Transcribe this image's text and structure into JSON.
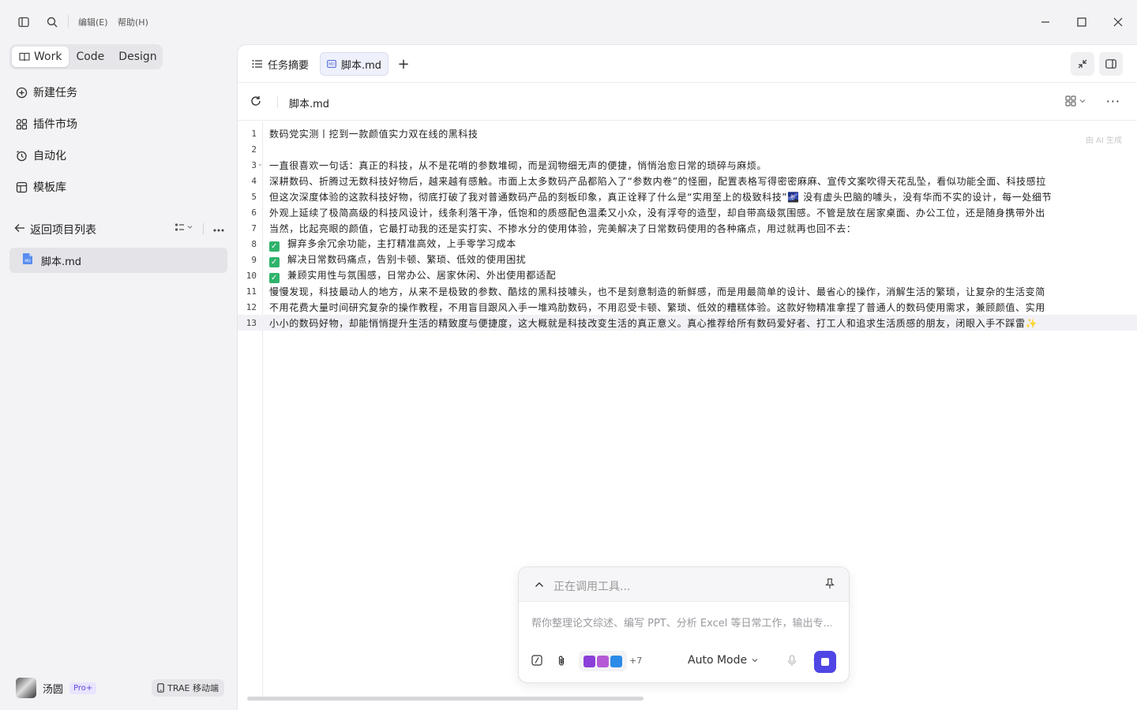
{
  "titlebar": {
    "menu_edit": "编辑(E)",
    "menu_help": "帮助(H)"
  },
  "sidebar": {
    "modes": [
      "Work",
      "Code",
      "Design"
    ],
    "nav": [
      {
        "label": "新建任务",
        "icon": "new-task-icon"
      },
      {
        "label": "插件市场",
        "icon": "plugin-market-icon"
      },
      {
        "label": "自动化",
        "icon": "automation-icon"
      },
      {
        "label": "模板库",
        "icon": "template-icon"
      }
    ],
    "back_label": "返回项目列表",
    "file_name": "脚本.md",
    "user_name": "汤圆",
    "badge": "Pro+",
    "mobile_label": "TRAE 移动端"
  },
  "tabs": {
    "summary": "任务摘要",
    "file": "脚本.md",
    "add": "+"
  },
  "filebar": {
    "name": "脚本.md",
    "more": "···"
  },
  "editor": {
    "ai_tag": "由 AI 生成",
    "current_line": 13,
    "lines": [
      "数码党实测丨挖到一款颜值实力双在线的黑科技",
      "",
      "一直很喜欢一句话：真正的科技，从不是花哨的参数堆砌，而是润物细无声的便捷，悄悄治愈日常的琐碎与麻烦。",
      "深耕数码、折腾过无数科技好物后，越来越有感触。市面上太多数码产品都陷入了“参数内卷”的怪圈，配置表格写得密密麻麻、宣传文案吹得天花乱坠，看似功能全面、科技感拉",
      "但这次深度体验的这款科技好物，彻底打破了我对普通数码产品的刻板印象，真正诠释了什么是“实用至上的极致科技”🌌 没有虚头巴脑的噱头，没有华而不实的设计，每一处细节",
      "外观上延续了极简高级的科技风设计，线条利落干净，低饱和的质感配色温柔又小众，没有浮夸的造型，却自带高级氛围感。不管是放在居家桌面、办公工位，还是随身携带外出",
      "当然，比起亮眼的颜值，它最打动我的还是实打实、不掺水分的使用体验，完美解决了日常数码使用的各种痛点，用过就再也回不去：",
      "摒弃多余冗余功能，主打精准高效，上手零学习成本",
      "解决日常数码痛点，告别卡顿、繁琐、低效的使用困扰",
      "兼顾实用性与氛围感，日常办公、居家休闲、外出使用都适配",
      "慢慢发现，科技最动人的地方，从来不是极致的参数、酷炫的黑科技噱头，也不是刻意制造的新鲜感，而是用最简单的设计、最省心的操作，消解生活的繁琐，让复杂的生活变简",
      "不用花费大量时间研究复杂的操作教程，不用盲目跟风入手一堆鸡肋数码，不用忍受卡顿、繁琐、低效的糟糕体验。这款好物精准拿捏了普通人的数码使用需求，兼顾颜值、实用",
      "小小的数码好物，却能悄悄提升生活的精致度与便捷度，这大概就是科技改变生活的真正意义。真心推荐给所有数码爱好者、打工人和追求生活质感的朋友，闭眼入手不踩雷✨"
    ]
  },
  "chat": {
    "status": "正在调用工具...",
    "placeholder": "帮你整理论文综述、编写 PPT、分析 Excel 等日常工作，输出专...",
    "more_count": "+7",
    "mode": "Auto Mode"
  },
  "colors": {
    "accent": "#4f46e5",
    "check": "#2fb36c",
    "badge_bg": "#e8e4ff"
  }
}
